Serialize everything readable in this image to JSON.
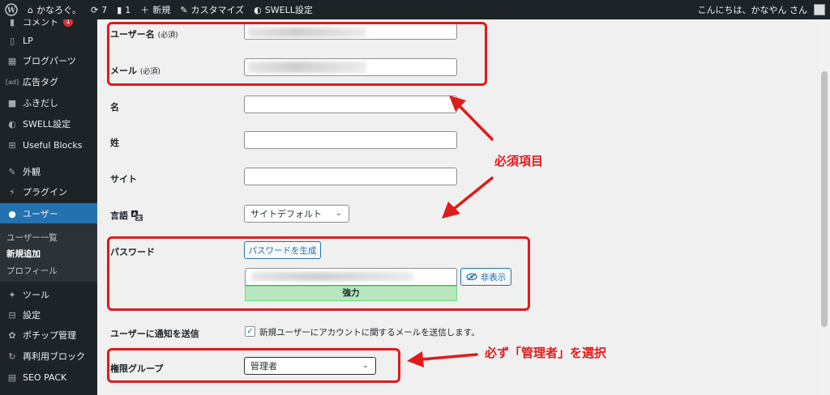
{
  "adminbar": {
    "site_name": "かなろぐ。",
    "updates_count": "7",
    "comments_count": "1",
    "new_label": "新規",
    "customize_label": "カスタマイズ",
    "swell_label": "SWELL設定",
    "greeting": "こんにちは、かなやん さん"
  },
  "sidebar": {
    "comments_badge": "1",
    "items": [
      {
        "label": "コメント",
        "icon": "comment-icon"
      },
      {
        "label": "LP",
        "icon": "page-icon"
      },
      {
        "label": "ブログパーツ",
        "icon": "blocks-icon"
      },
      {
        "label": "広告タグ",
        "icon": "ad-icon"
      },
      {
        "label": "ふきだし",
        "icon": "bubble-icon"
      },
      {
        "label": "SWELL設定",
        "icon": "swell-icon"
      },
      {
        "label": "Useful Blocks",
        "icon": "grid-icon"
      },
      {
        "label": "外観",
        "icon": "brush-icon"
      },
      {
        "label": "プラグイン",
        "icon": "plugin-icon"
      },
      {
        "label": "ユーザー",
        "icon": "user-icon"
      },
      {
        "label": "ツール",
        "icon": "wrench-icon"
      },
      {
        "label": "設定",
        "icon": "settings-icon"
      },
      {
        "label": "ポチップ管理",
        "icon": "gear-icon"
      },
      {
        "label": "再利用ブロック",
        "icon": "reload-icon"
      },
      {
        "label": "SEO PACK",
        "icon": "seo-icon"
      }
    ],
    "submenu": [
      "ユーザー一覧",
      "新規追加",
      "プロフィール"
    ]
  },
  "form": {
    "username_label": "ユーザー名",
    "username_required": "(必須)",
    "email_label": "メール",
    "email_required": "(必須)",
    "firstname_label": "名",
    "lastname_label": "姓",
    "site_label": "サイト",
    "language_label": "言語",
    "language_value": "サイトデフォルト",
    "password_label": "パスワード",
    "generate_password_button": "パスワードを生成",
    "hide_button": "非表示",
    "strength_text": "強力",
    "notify_label": "ユーザーに通知を送信",
    "notify_text": "新規ユーザーにアカウントに関するメールを送信します。",
    "role_label": "権限グループ",
    "role_value": "管理者"
  },
  "annotations": {
    "required_note": "必須項目",
    "admin_note": "必ず「管理者」を選択"
  },
  "colors": {
    "annotation_red": "#e11a1a",
    "wp_blue": "#2271b1",
    "wp_dark": "#1d2327"
  }
}
